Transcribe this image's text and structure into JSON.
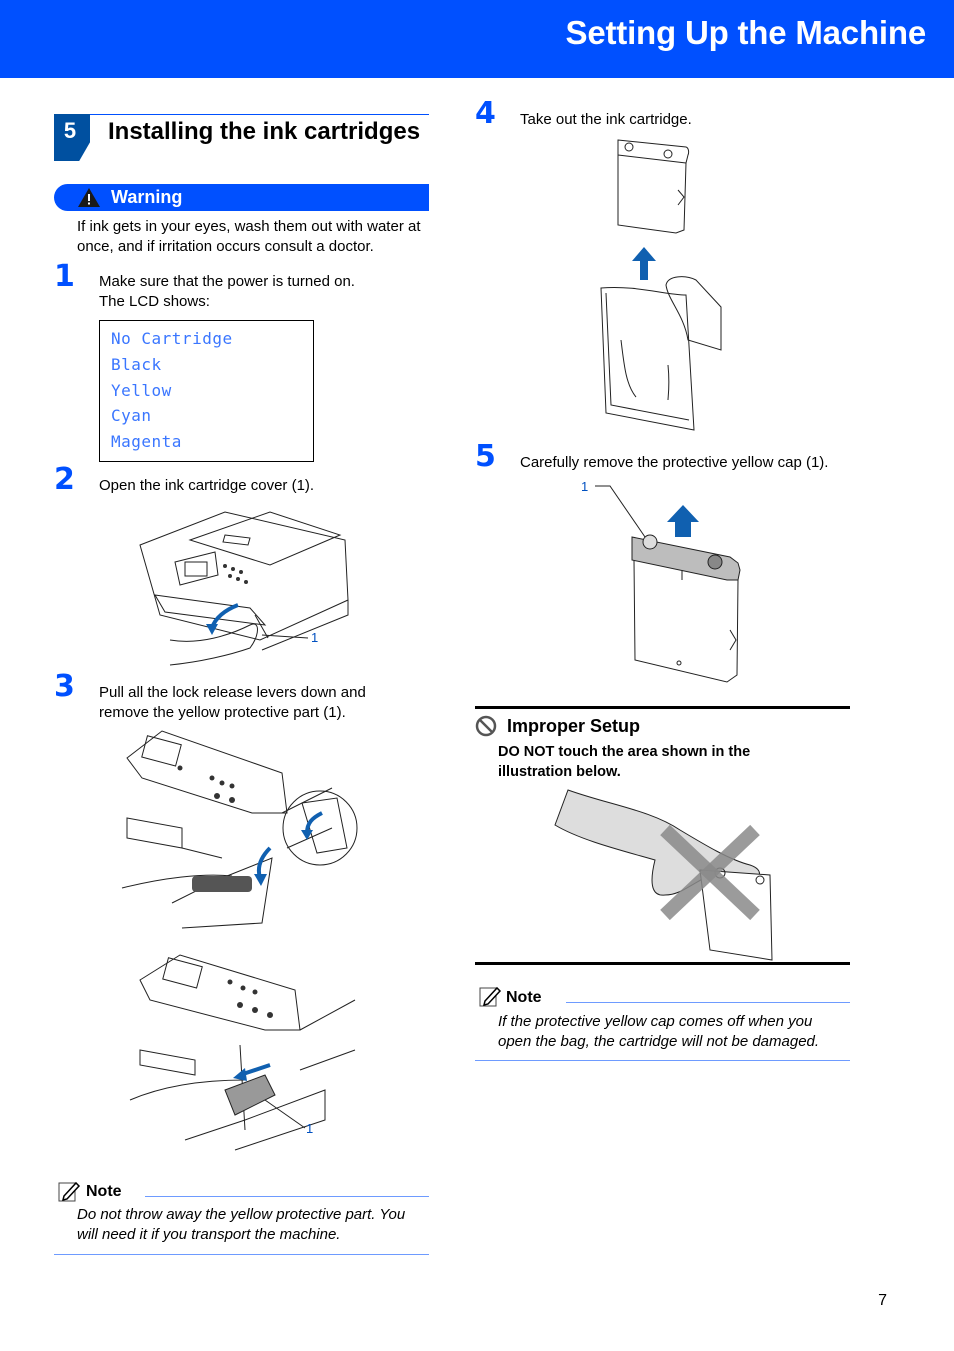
{
  "header": {
    "title": "Setting Up the Machine"
  },
  "section": {
    "number": "5",
    "title": "Installing the ink cartridges"
  },
  "warning": {
    "label": "Warning",
    "icon": "warning-triangle-icon",
    "text": "If ink gets in your eyes, wash them out with water at once, and if irritation occurs consult a doctor."
  },
  "steps": [
    {
      "number": "1",
      "lines": [
        "Make sure that the power is turned on.",
        "The LCD shows:"
      ]
    },
    {
      "number": "2",
      "lines": [
        "Open the ink cartridge cover (1)."
      ]
    },
    {
      "number": "3",
      "lines": [
        "Pull all the lock release levers down and",
        "remove the yellow protective part (1)."
      ]
    },
    {
      "number": "4",
      "lines": [
        "Take out the ink cartridge."
      ]
    },
    {
      "number": "5",
      "lines": [
        "Carefully remove the protective yellow cap (1)."
      ]
    }
  ],
  "lcd": {
    "lines": [
      "No Cartridge",
      "Black",
      "Yellow",
      "Cyan",
      "Magenta"
    ]
  },
  "callouts": {
    "step2": "1",
    "step3": "1",
    "step5": "1"
  },
  "note_left": {
    "label": "Note",
    "icon": "note-pencil-icon",
    "lines": [
      "Do not throw away the yellow protective part. You",
      "will need it if you transport the machine."
    ]
  },
  "improper": {
    "title": "Improper Setup",
    "icon": "prohibited-icon",
    "lines": [
      "DO NOT touch the area shown in the",
      "illustration below."
    ]
  },
  "note_right": {
    "label": "Note",
    "icon": "note-pencil-icon",
    "lines": [
      "If the protective yellow cap comes off when you",
      "open the bag, the cartridge will not be damaged."
    ]
  },
  "page_number": "7",
  "colors": {
    "brand_blue": "#0050ff",
    "section_blue": "#0050a0",
    "lcd_text": "#3a76ff",
    "note_rule": "#6e9bff",
    "arrow_blue": "#1060b0"
  }
}
